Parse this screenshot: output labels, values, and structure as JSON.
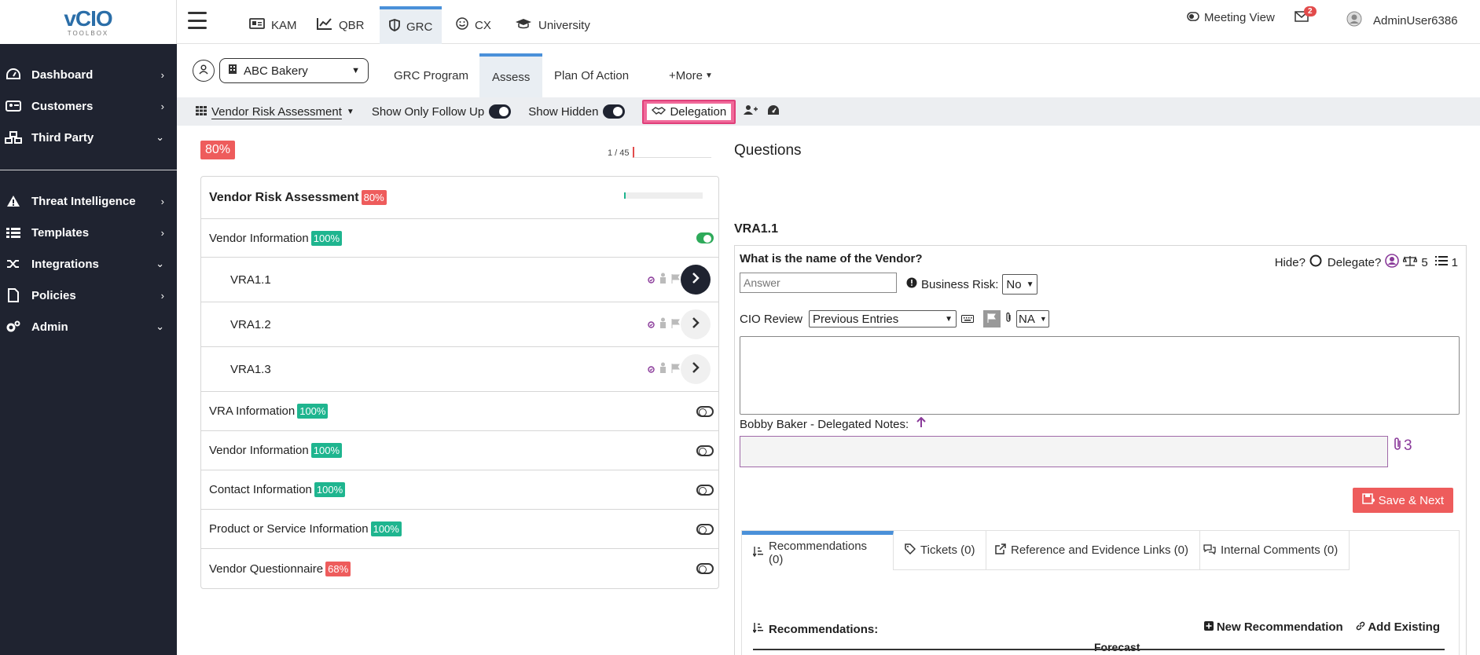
{
  "logo": {
    "line1": "vCIO",
    "line2": "TOOLBOX"
  },
  "sidebar": {
    "items": [
      {
        "label": "Dashboard",
        "arrow": "›"
      },
      {
        "label": "Customers",
        "arrow": "›"
      },
      {
        "label": "Third Party",
        "arrow": "⌄"
      },
      {
        "label": "Threat Intelligence",
        "arrow": "›"
      },
      {
        "label": "Templates",
        "arrow": "›"
      },
      {
        "label": "Integrations",
        "arrow": "⌄"
      },
      {
        "label": "Policies",
        "arrow": "›"
      },
      {
        "label": "Admin",
        "arrow": "⌄"
      }
    ]
  },
  "topnav": {
    "tabs": [
      {
        "label": "KAM"
      },
      {
        "label": "QBR"
      },
      {
        "label": "GRC"
      },
      {
        "label": "CX"
      },
      {
        "label": "University"
      }
    ],
    "meeting_view": "Meeting View",
    "mail_count": "2",
    "user": "AdminUser6386"
  },
  "subnav": {
    "customer": "ABC Bakery",
    "tabs": [
      {
        "label": "GRC Program"
      },
      {
        "label": "Assess"
      },
      {
        "label": "Plan Of Action"
      },
      {
        "label": "+More"
      }
    ]
  },
  "toolbar": {
    "assessment": "Vendor Risk Assessment",
    "follow_up": "Show Only Follow Up",
    "hidden": "Show Hidden",
    "delegation": "Delegation"
  },
  "progress": {
    "overall": "80%",
    "counter": "1 / 45"
  },
  "sections": {
    "header": {
      "title": "Vendor Risk Assessment",
      "pct": "80%"
    },
    "group1": {
      "title": "Vendor Information",
      "pct": "100%"
    },
    "questions": [
      {
        "code": "VRA1.1"
      },
      {
        "code": "VRA1.2"
      },
      {
        "code": "VRA1.3"
      }
    ],
    "rows": [
      {
        "title": "VRA Information",
        "pct": "100%"
      },
      {
        "title": "Vendor Information",
        "pct": "100%"
      },
      {
        "title": "Contact Information",
        "pct": "100%"
      },
      {
        "title": "Product or Service Information",
        "pct": "100%"
      },
      {
        "title": "Vendor Questionnaire",
        "pct": "68%"
      }
    ]
  },
  "question": {
    "panel_title": "Questions",
    "code": "VRA1.1",
    "text": "What is the name of the Vendor?",
    "hide_label": "Hide?",
    "delegate_label": "Delegate?",
    "weight": "5",
    "list_count": "1",
    "answer_placeholder": "Answer",
    "business_risk_label": "Business Risk:",
    "business_risk_value": "No",
    "cio_review_label": "CIO Review",
    "previous_entries": "Previous Entries",
    "na_value": "NA",
    "delegated_notes_label": "Bobby Baker - Delegated Notes:",
    "attachment_count": "3",
    "save_next": "Save & Next"
  },
  "rec_tabs": [
    {
      "label": "Recommendations (0)"
    },
    {
      "label": "Tickets (0)"
    },
    {
      "label": "Reference and Evidence Links (0)"
    },
    {
      "label": "Internal Comments (0)"
    }
  ],
  "recommendations": {
    "heading": "Recommendations:",
    "new": "New Recommendation",
    "add_existing": "Add Existing",
    "col_forecast": "Forecast"
  }
}
